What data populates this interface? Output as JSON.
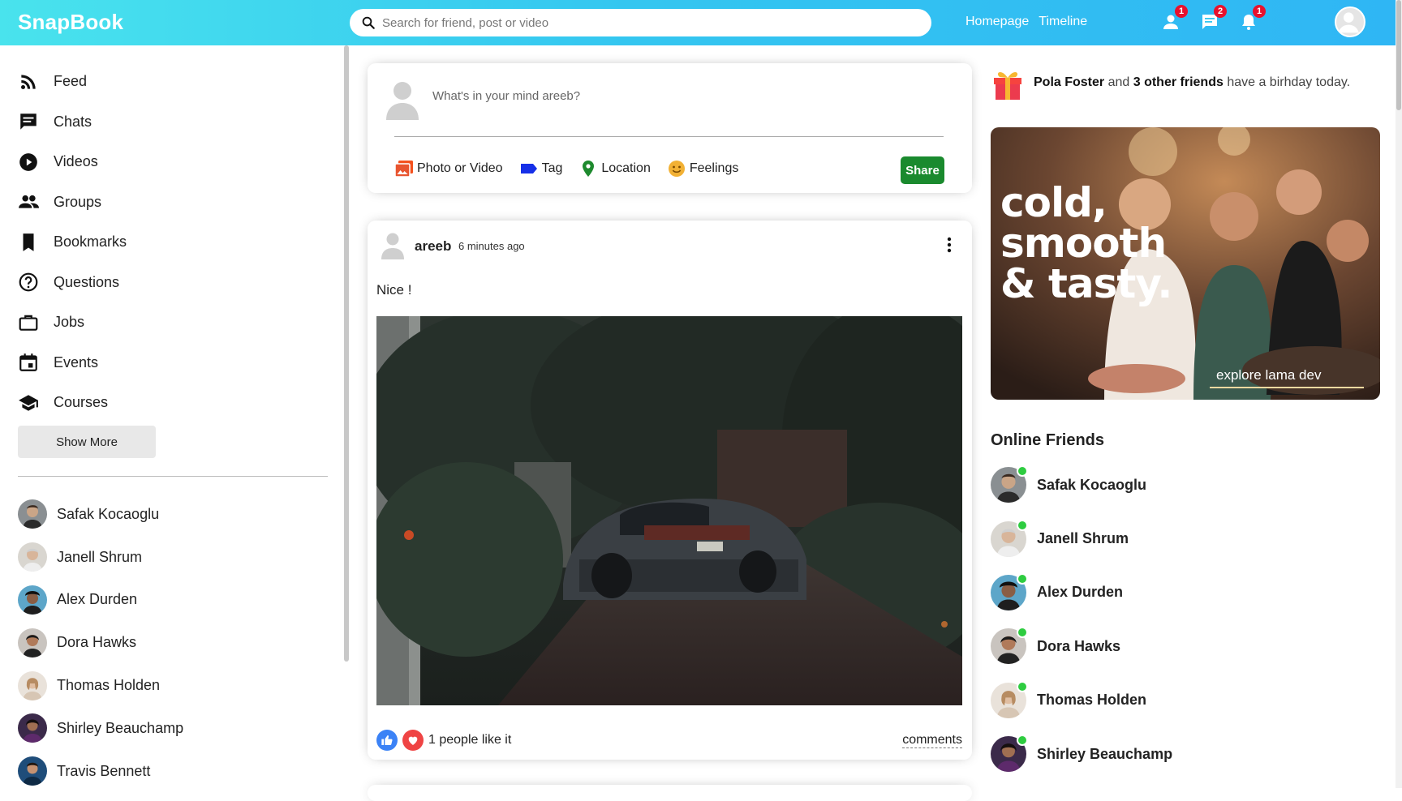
{
  "header": {
    "logo": "SnapBook",
    "search_placeholder": "Search for friend, post or video",
    "links": [
      "Homepage",
      "Timeline"
    ],
    "badges": {
      "friends": "1",
      "messages": "2",
      "notifications": "1"
    }
  },
  "sidebar": {
    "menu": [
      {
        "label": "Feed",
        "icon": "rss-icon"
      },
      {
        "label": "Chats",
        "icon": "chat-icon"
      },
      {
        "label": "Videos",
        "icon": "play-circle-icon"
      },
      {
        "label": "Groups",
        "icon": "group-icon"
      },
      {
        "label": "Bookmarks",
        "icon": "bookmark-icon"
      },
      {
        "label": "Questions",
        "icon": "help-circle-icon"
      },
      {
        "label": "Jobs",
        "icon": "briefcase-icon"
      },
      {
        "label": "Events",
        "icon": "calendar-icon"
      },
      {
        "label": "Courses",
        "icon": "graduation-cap-icon"
      }
    ],
    "show_more": "Show More",
    "friends": [
      "Safak Kocaoglu",
      "Janell Shrum",
      "Alex Durden",
      "Dora Hawks",
      "Thomas Holden",
      "Shirley Beauchamp",
      "Travis Bennett"
    ]
  },
  "share": {
    "placeholder": "What's in your mind areeb?",
    "options": [
      "Photo or Video",
      "Tag",
      "Location",
      "Feelings"
    ],
    "button": "Share"
  },
  "post": {
    "username": "areeb",
    "time": "6 minutes ago",
    "text": "Nice !",
    "likes": "1 people like it",
    "comments": "comments"
  },
  "rightbar": {
    "birthday": {
      "name": "Pola Foster",
      "mid": " and ",
      "count": "3 other friends",
      "tail": " have a birhday today."
    },
    "ad": {
      "title": "cold,\nsmooth\n& tasty.",
      "footer": "explore lama dev"
    },
    "online_title": "Online Friends",
    "online": [
      "Safak Kocaoglu",
      "Janell Shrum",
      "Alex Durden",
      "Dora Hawks",
      "Thomas Holden",
      "Shirley Beauchamp"
    ]
  },
  "colors": {
    "header_start": "#49e3ed",
    "header_end": "#2fb6f4",
    "share_button": "#1a8a2e",
    "badge": "#e8112d",
    "online_dot": "#2ecc40"
  }
}
